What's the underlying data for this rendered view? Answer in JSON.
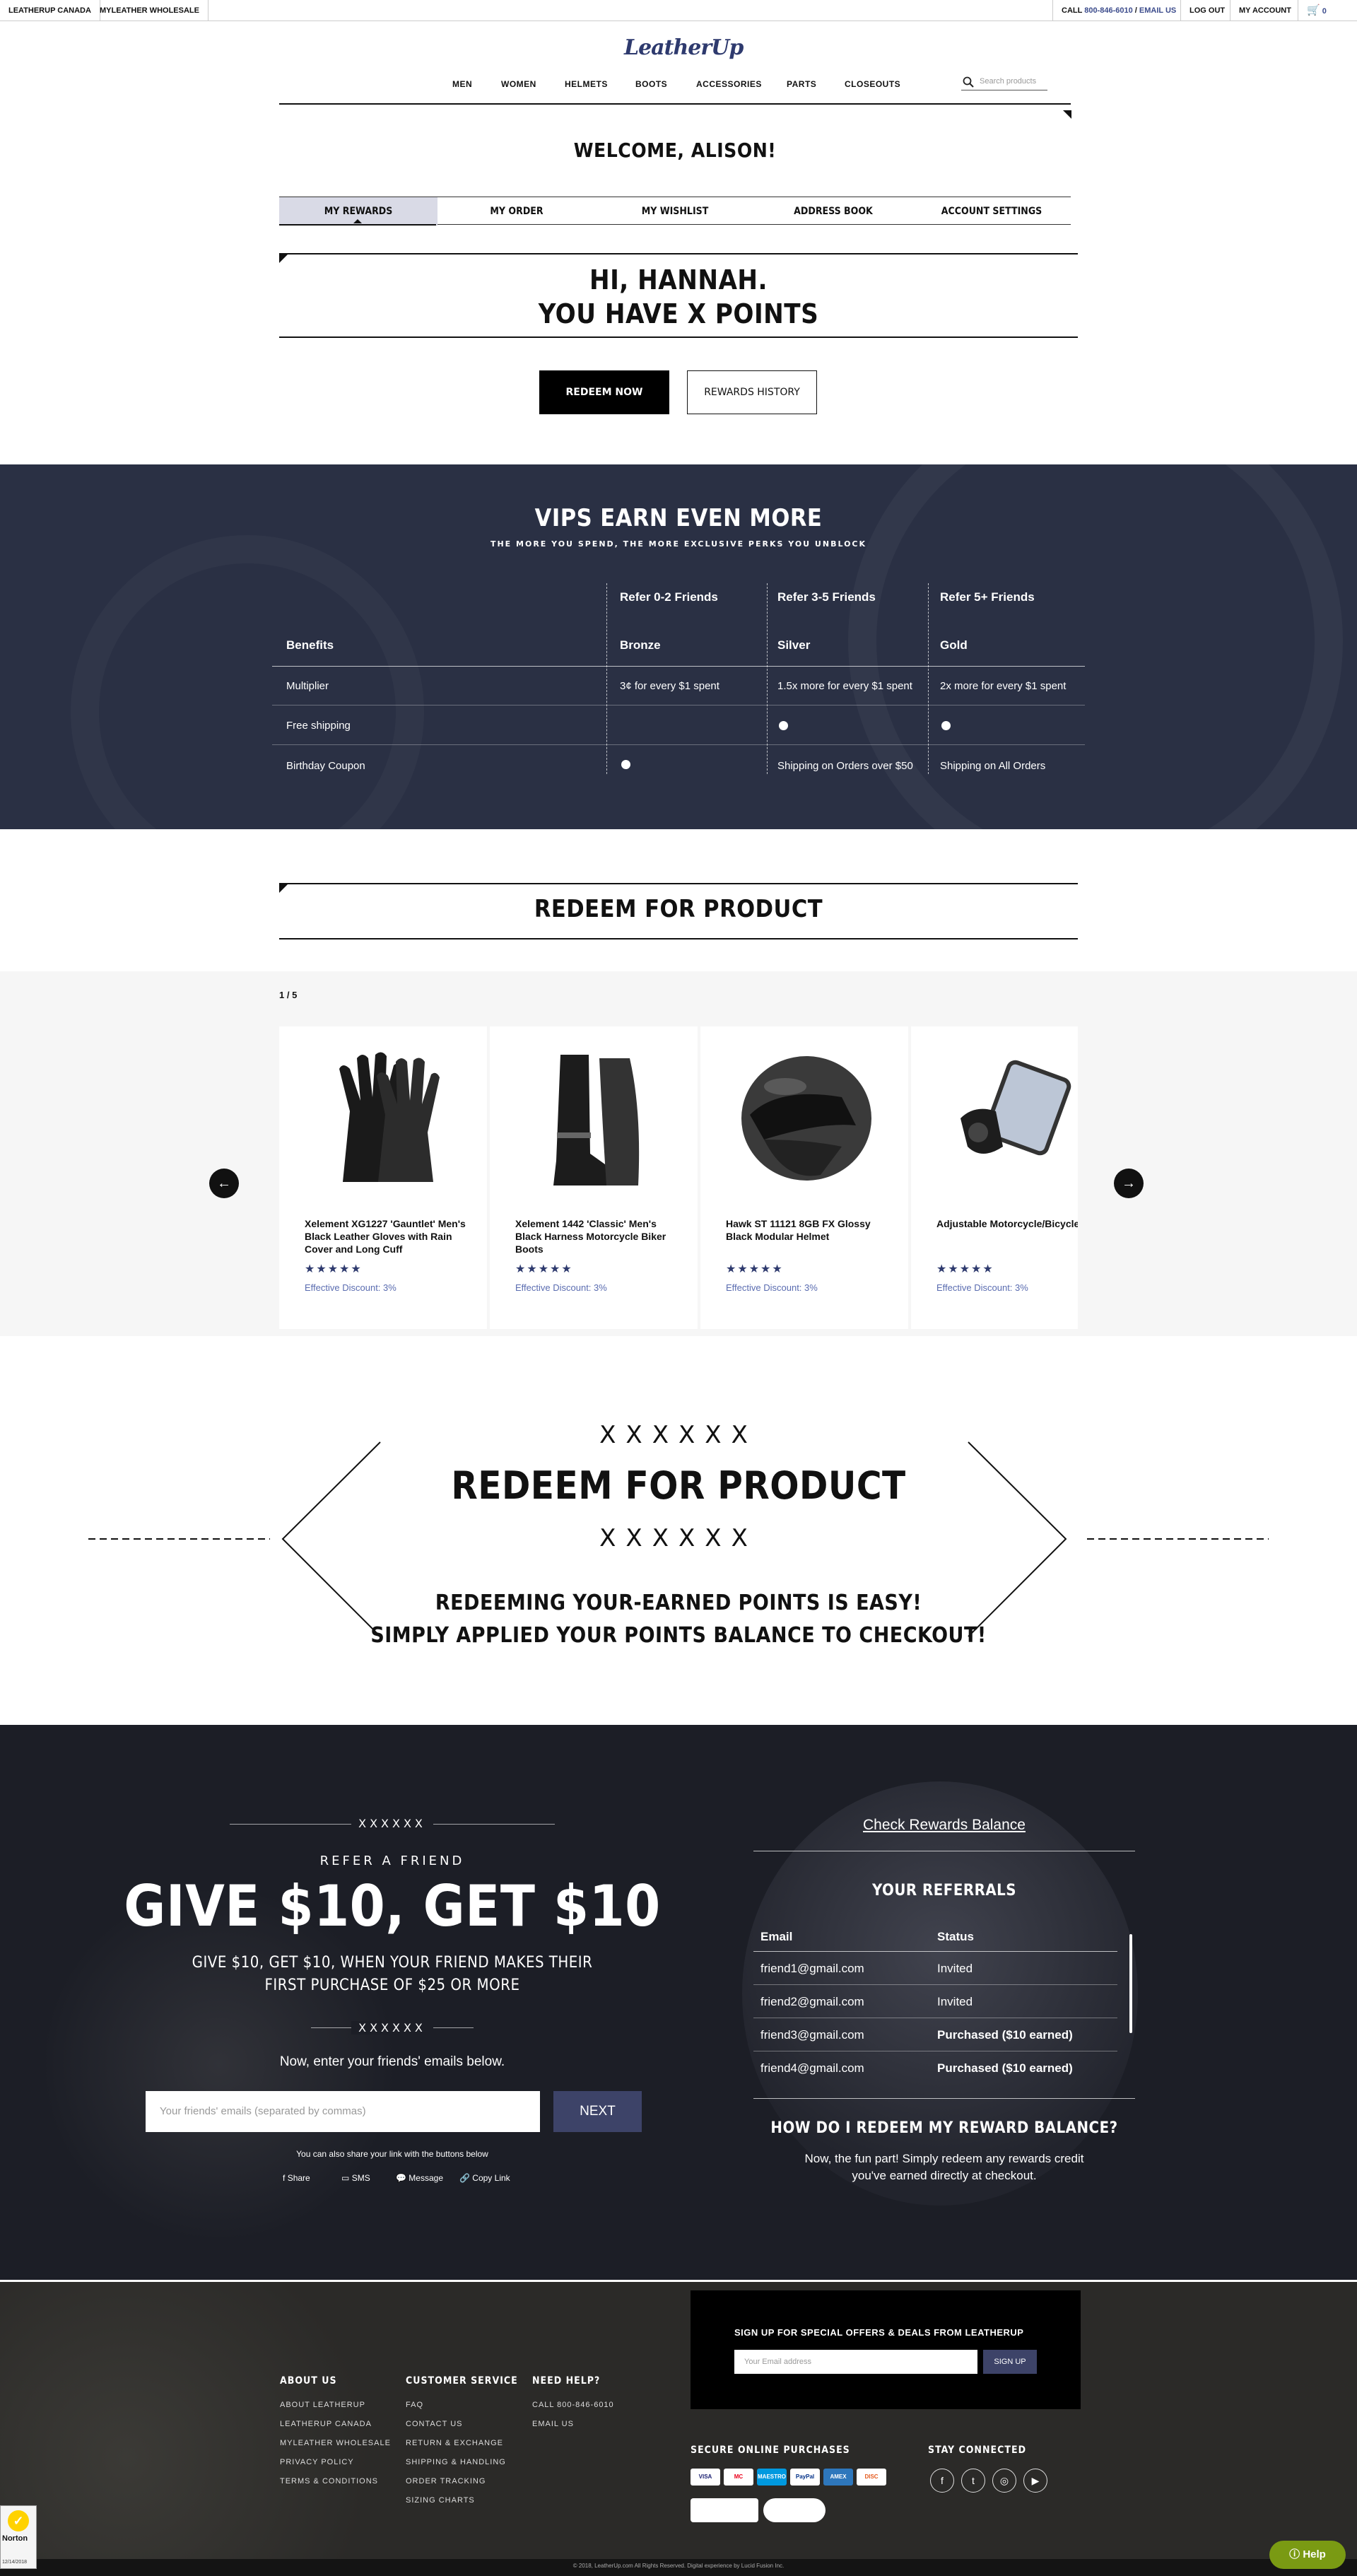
{
  "topbar": {
    "left_links": [
      "LEATHERUP CANADA",
      "MYLEATHER WHOLESALE"
    ],
    "call_label": "CALL",
    "phone": "800-846-6010",
    "sep": "/",
    "email_label": "EMAIL US",
    "logout": "LOG OUT",
    "account": "MY ACCOUNT",
    "cart_count": "0"
  },
  "logo": "LeatherUp",
  "nav": [
    "MEN",
    "WOMEN",
    "HELMETS",
    "BOOTS",
    "ACCESSORIES",
    "PARTS",
    "CLOSEOUTS"
  ],
  "search": {
    "placeholder": "Search products"
  },
  "welcome": "WELCOME, ALISON!",
  "tabs": [
    "MY REWARDS",
    "MY ORDER",
    "MY WISHLIST",
    "ADDRESS BOOK",
    "ACCOUNT SETTINGS"
  ],
  "greeting": {
    "line1": "HI, HANNAH.",
    "line2": "YOU HAVE X POINTS"
  },
  "buttons": {
    "redeem": "REDEEM NOW",
    "history": "REWARDS HISTORY"
  },
  "vip": {
    "title": "VIPS EARN EVEN MORE",
    "subtitle": "THE MORE YOU SPEND, THE MORE EXCLUSIVE PERKS YOU UNBLOCK",
    "refer_headers": [
      "Refer 0-2 Friends",
      "Refer 3-5 Friends",
      "Refer 5+ Friends"
    ],
    "benefits_label": "Benefits",
    "tiers": [
      "Bronze",
      "Silver",
      "Gold"
    ],
    "rows": [
      {
        "label": "Multiplier",
        "values": [
          "3¢ for every $1 spent",
          "1.5x more for every $1 spent",
          "2x more for every $1 spent"
        ]
      },
      {
        "label": "Free shipping",
        "values": [
          "",
          "",
          ""
        ]
      },
      {
        "label": "Birthday Coupon",
        "values": [
          "",
          "Shipping on Orders over $50",
          "Shipping on All Orders"
        ]
      }
    ]
  },
  "redeem_section": {
    "title": "REDEEM FOR PRODUCT",
    "pager": "1 / 5"
  },
  "products": [
    {
      "name": "Xelement XG1227 'Gauntlet' Men's Black Leather Gloves with Rain Cover and Long Cuff",
      "stars": "★★★★★",
      "discount": "Effective Discount: 3%"
    },
    {
      "name": "Xelement 1442 'Classic' Men's Black Harness Motorcycle Biker Boots",
      "stars": "★★★★★",
      "discount": "Effective Discount: 3%"
    },
    {
      "name": "Hawk ST 11121 8GB FX Glossy Black Modular Helmet",
      "stars": "★★★★★",
      "discount": "Effective Discount: 3%"
    },
    {
      "name": "Adjustable Motorcycle/Bicycle Phone Mount",
      "stars": "★★★★★",
      "discount": "Effective Discount: 3%"
    }
  ],
  "banner": {
    "marks": "XXXXXX",
    "title": "REDEEM FOR PRODUCT",
    "line1": "REDEEMING YOUR-EARNED POINTS IS EASY!",
    "line2": "SIMPLY APPLIED YOUR POINTS BALANCE TO CHECKOUT!"
  },
  "refer": {
    "marks": "XXXXXX",
    "kicker": "REFER A FRIEND",
    "title": "GIVE $10, GET $10",
    "subtitle_1": "GIVE $10, GET $10, WHEN YOUR FRIEND MAKES THEIR",
    "subtitle_2": "FIRST PURCHASE OF $25 OR MORE",
    "enter": "Now, enter your friends' emails below.",
    "input_placeholder": "Your friends' emails (separated by commas)",
    "next": "NEXT",
    "share_note": "You can also share your link with the buttons below",
    "share": [
      "Share",
      "SMS",
      "Message",
      "Copy Link"
    ],
    "check_balance": "Check Rewards Balance",
    "referrals_title": "YOUR REFERRALS",
    "col_email": "Email",
    "col_status": "Status",
    "referrals": [
      {
        "email": "friend1@gmail.com",
        "status": "Invited"
      },
      {
        "email": "friend2@gmail.com",
        "status": "Invited"
      },
      {
        "email": "friend3@gmail.com",
        "status": "Purchased ($10 earned)"
      },
      {
        "email": "friend4@gmail.com",
        "status": "Purchased ($10 earned)"
      }
    ],
    "faq_title": "HOW DO I REDEEM MY REWARD BALANCE?",
    "faq_1": "Now, the fun part! Simply redeem any rewards credit",
    "faq_2": "you've earned directly at checkout."
  },
  "footer": {
    "signup_title": "SIGN UP FOR SPECIAL OFFERS & DEALS FROM LEATHERUP",
    "email_placeholder": "Your Email address",
    "signup_btn": "SIGN UP",
    "about_title": "ABOUT US",
    "about": [
      "ABOUT LEATHERUP",
      "LEATHERUP CANADA",
      "MYLEATHER WHOLESALE",
      "PRIVACY POLICY",
      "TERMS & CONDITIONS"
    ],
    "service_title": "CUSTOMER SERVICE",
    "service": [
      "FAQ",
      "CONTACT US",
      "RETURN & EXCHANGE",
      "SHIPPING & HANDLING",
      "ORDER TRACKING",
      "SIZING CHARTS"
    ],
    "help_title": "NEED HELP?",
    "help": [
      "CALL 800-846-6010",
      "EMAIL US"
    ],
    "secure_title": "SECURE ONLINE PURCHASES",
    "payments": [
      "VISA",
      "MC",
      "MAESTRO",
      "PayPal",
      "AMEX",
      "DISC"
    ],
    "connected_title": "STAY CONNECTED",
    "copyright": "© 2018, LeatherUp.com All Rights Reserved. Digital experience by Lucid Fusion Inc.",
    "help_btn": "Help",
    "norton": "Norton",
    "norton_date": "12/14/2018"
  }
}
